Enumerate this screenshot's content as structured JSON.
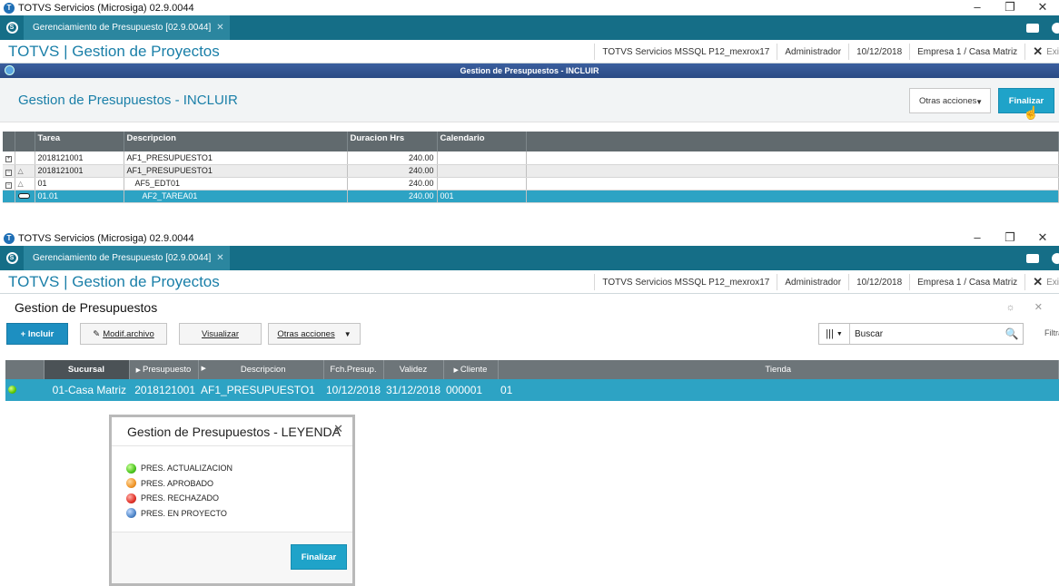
{
  "top": {
    "window_title": "TOTVS Servicios (Microsiga) 02.9.0044",
    "tab_label": "Gerenciamiento de Presupuesto [02.9.0044]",
    "app_title": "TOTVS | Gestion de Proyectos",
    "header_info": [
      "TOTVS Servicios MSSQL P12_mexrox17",
      "Administrador",
      "10/12/2018",
      "Empresa 1 / Casa Matriz"
    ],
    "exit_label": "Exi",
    "dialog_bar_title": "Gestion de Presupuestos - INCLUIR",
    "dialog_title": "Gestion de Presupuestos - INCLUIR",
    "otras_acciones": "Otras acciones",
    "finalizar": "Finalizar",
    "grid_columns": [
      "Tarea",
      "Descripcion",
      "Duracion Hrs",
      "Calendario"
    ],
    "grid_rows": [
      {
        "tarea": "2018121001",
        "descripcion": "AF1_PRESUPUESTO1",
        "duracion": "240.00",
        "calendario": ""
      },
      {
        "tarea": "2018121001",
        "descripcion": "AF1_PRESUPUESTO1",
        "duracion": "240.00",
        "calendario": ""
      },
      {
        "tarea": "01",
        "descripcion": "AF5_EDT01",
        "duracion": "240.00",
        "calendario": ""
      },
      {
        "tarea": "01.01",
        "descripcion": "AF2_TAREA01",
        "duracion": "240.00",
        "calendario": "001"
      }
    ]
  },
  "bottom": {
    "window_title": "TOTVS Servicios (Microsiga) 02.9.0044",
    "tab_label": "Gerenciamiento de Presupuesto [02.9.0044]",
    "app_title": "TOTVS | Gestion de Proyectos",
    "header_info": [
      "TOTVS Servicios MSSQL P12_mexrox17",
      "Administrador",
      "10/12/2018",
      "Empresa 1 / Casa Matriz"
    ],
    "exit_label": "Exi",
    "browse_title": "Gestion de Presupuestos",
    "buttons": {
      "incluir": "+ Incluir",
      "modif": "Modif.archivo",
      "visualizar": "Visualizar",
      "otras": "Otras acciones"
    },
    "search_placeholder": "Buscar",
    "filtrar": "Filtra",
    "columns": [
      "Sucursal",
      "Presupuesto",
      "Descripcion",
      "Fch.Presup.",
      "Validez",
      "Cliente",
      "Tienda"
    ],
    "row": {
      "sucursal": "01-Casa Matriz",
      "presupuesto": "2018121001",
      "descripcion": "AF1_PRESUPUESTO1",
      "fecha": "10/12/2018",
      "validez": "31/12/2018",
      "cliente": "000001",
      "tienda": "01"
    },
    "legend": {
      "title": "Gestion de Presupuestos - LEYENDA",
      "items": [
        {
          "label": "PRES. ACTUALIZACION",
          "color": "#4cc61e"
        },
        {
          "label": "PRES. APROBADO",
          "color": "#f0962a"
        },
        {
          "label": "PRES. RECHAZADO",
          "color": "#e2332a"
        },
        {
          "label": "PRES. EN PROYECTO",
          "color": "#4f86c9"
        }
      ],
      "button": "Finalizar"
    }
  }
}
